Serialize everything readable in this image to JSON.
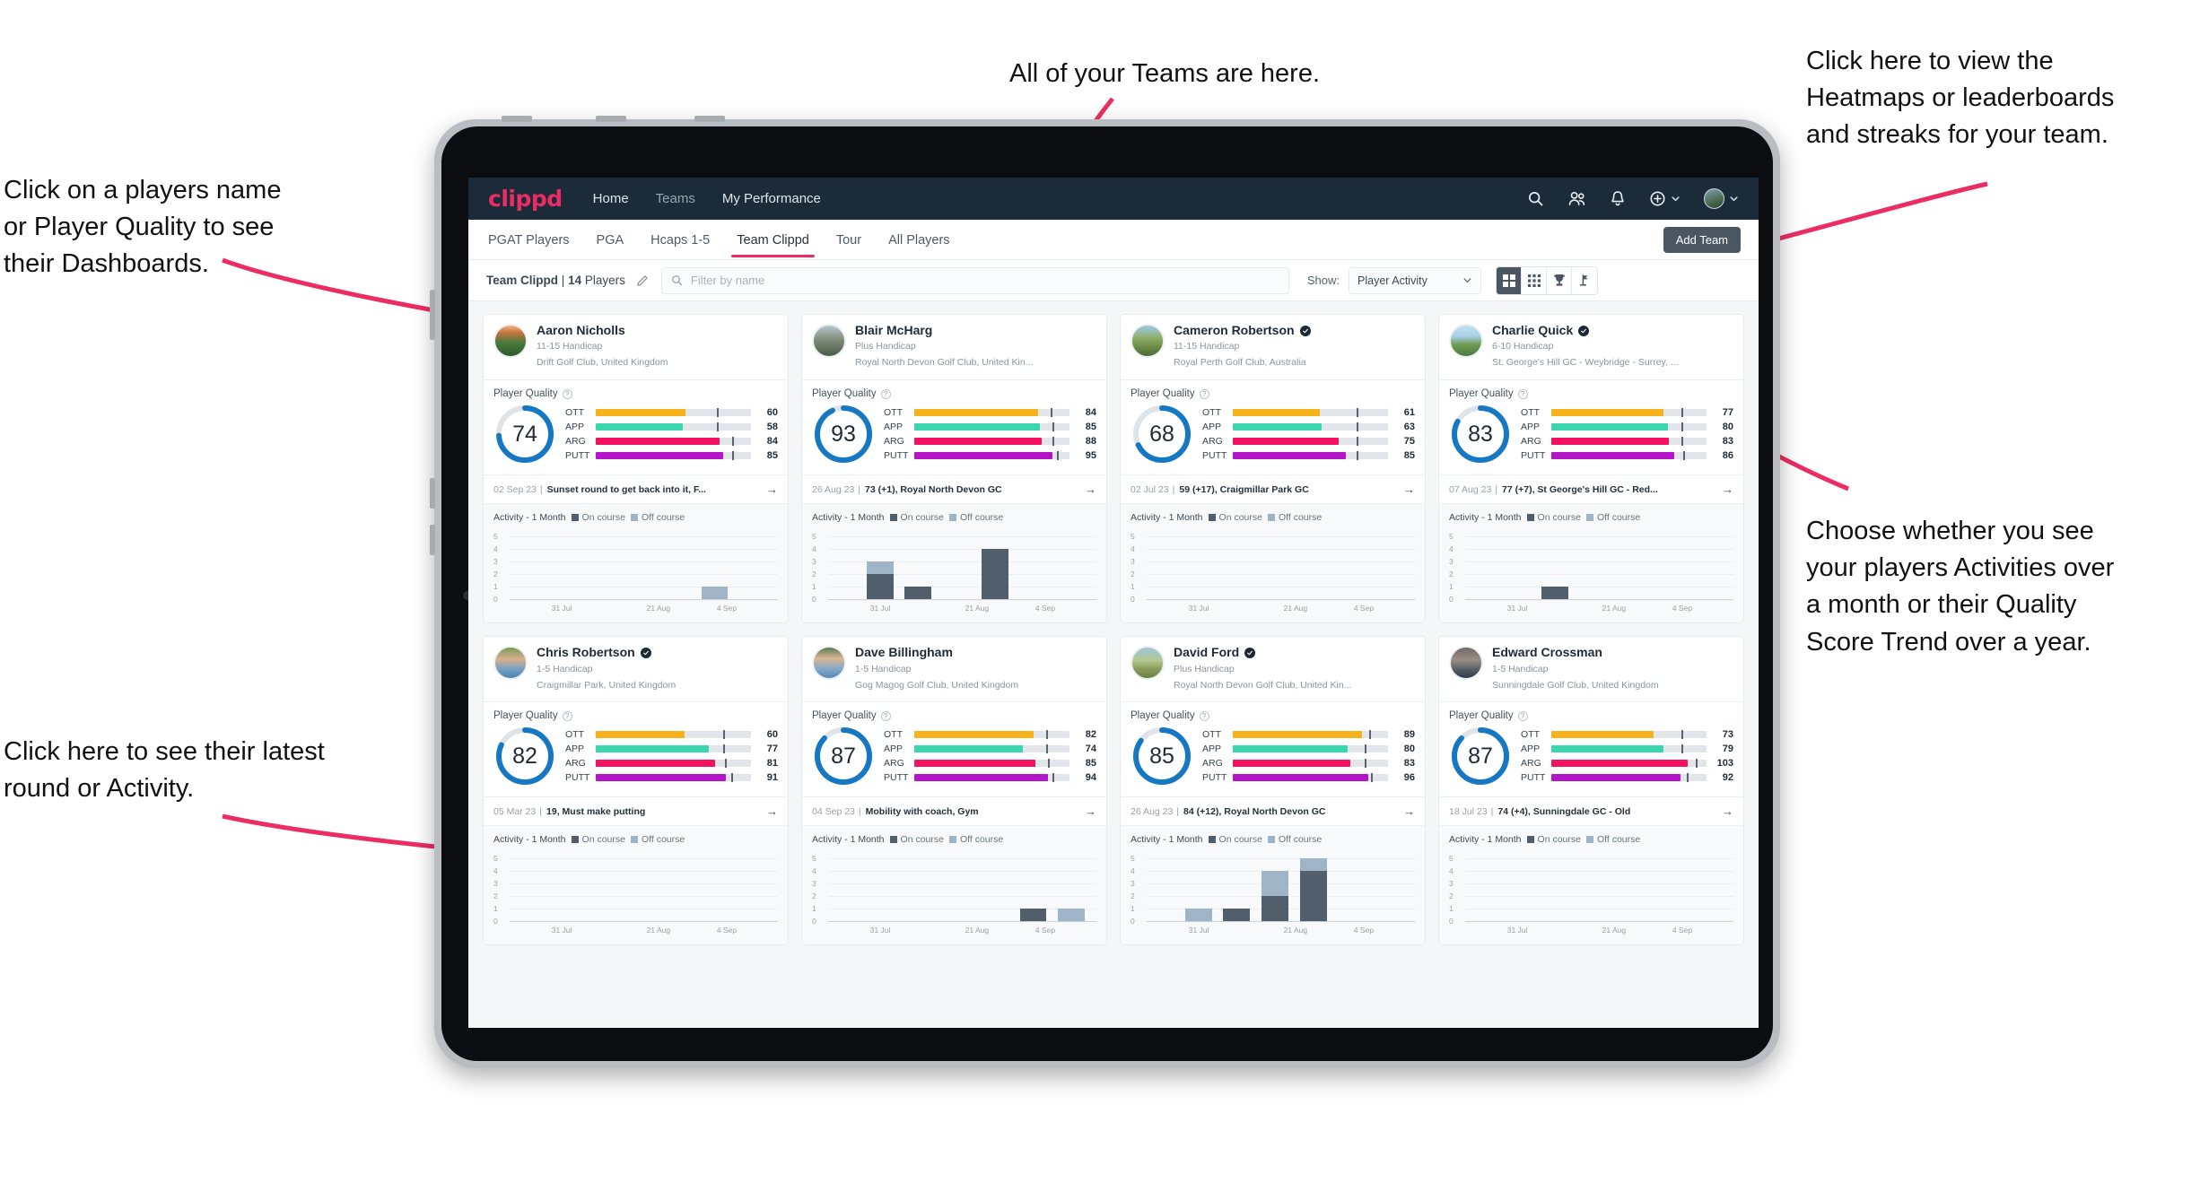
{
  "annotations": [
    {
      "id": "teams",
      "text": "All of your Teams are here."
    },
    {
      "id": "heatmaps",
      "text": "Click here to view the\nHeatmaps or leaderboards\nand streaks for your team."
    },
    {
      "id": "players-name",
      "text": "Click on a players name\nor Player Quality to see\ntheir Dashboards."
    },
    {
      "id": "activity-choice",
      "text": "Choose whether you see\nyour players Activities over\na month or their Quality\nScore Trend over a year."
    },
    {
      "id": "latest-round",
      "text": "Click here to see their latest\nround or Activity."
    }
  ],
  "app": {
    "logo": "clippd",
    "nav": [
      {
        "label": "Home",
        "active": true
      },
      {
        "label": "Teams",
        "active": false
      },
      {
        "label": "My Performance",
        "active": true
      }
    ],
    "nav_icons": [
      "search-icon",
      "team-icon",
      "bell-icon",
      "plus-circle-icon",
      "avatar"
    ],
    "tabs": [
      {
        "label": "PGAT Players",
        "active": false
      },
      {
        "label": "PGA",
        "active": false
      },
      {
        "label": "Hcaps 1-5",
        "active": false
      },
      {
        "label": "Team Clippd",
        "active": true
      },
      {
        "label": "Tour",
        "active": false
      },
      {
        "label": "All Players",
        "active": false
      }
    ],
    "add_team_label": "Add Team",
    "filter": {
      "team_name": "Team Clippd",
      "team_count": "14",
      "team_count_suffix": "Players",
      "separator": "|",
      "search_placeholder": "Filter by name",
      "show_label": "Show:",
      "show_value": "Player Activity",
      "view_modes": [
        "grid-view-icon",
        "dense-grid-icon",
        "trophy-icon",
        "golf-pin-icon"
      ],
      "active_view": 0
    },
    "accent": "#ec2d63",
    "ring_color": "#1678c2",
    "metric_colors": {
      "OTT": "#f7b21b",
      "APP": "#3ad6ae",
      "ARG": "#f5115f",
      "PUTT": "#b515c9"
    }
  },
  "card_labels": {
    "player_quality": "Player Quality",
    "activity": "Activity - 1 Month",
    "on_course": "On course",
    "off_course": "Off course",
    "metric_names": [
      "OTT",
      "APP",
      "ARG",
      "PUTT"
    ]
  },
  "chart_data": {
    "type": "bar",
    "title": "Activity - 1 Month",
    "ylabel": "",
    "xlabel": "",
    "ylim": [
      0,
      5
    ],
    "yticks": [
      0,
      1,
      2,
      3,
      4,
      5
    ],
    "xticks": [
      "31 Jul",
      "21 Aug",
      "4 Sep"
    ],
    "legend": [
      "On course",
      "Off course"
    ],
    "legend_position": "top",
    "grid": true,
    "series_colors": {
      "on_course": "#515e6b",
      "off_course": "#9fb4c6"
    },
    "panels": [
      {
        "player": "Aaron Nicholls",
        "bars": [
          {
            "slot": 5,
            "on": 0,
            "off": 1
          }
        ]
      },
      {
        "player": "Blair McHarg",
        "bars": [
          {
            "slot": 1,
            "on": 2,
            "off": 1
          },
          {
            "slot": 2,
            "on": 1,
            "off": 0
          },
          {
            "slot": 4,
            "on": 4,
            "off": 0
          }
        ]
      },
      {
        "player": "Cameron Robertson",
        "bars": []
      },
      {
        "player": "Charlie Quick",
        "bars": [
          {
            "slot": 2,
            "on": 1,
            "off": 0
          }
        ]
      },
      {
        "player": "Chris Robertson",
        "bars": []
      },
      {
        "player": "Dave Billingham",
        "bars": [
          {
            "slot": 5,
            "on": 1,
            "off": 0
          },
          {
            "slot": 6,
            "on": 0,
            "off": 1
          }
        ]
      },
      {
        "player": "David Ford",
        "bars": [
          {
            "slot": 1,
            "on": 0,
            "off": 1
          },
          {
            "slot": 2,
            "on": 1,
            "off": 0
          },
          {
            "slot": 3,
            "on": 2,
            "off": 2
          },
          {
            "slot": 4,
            "on": 4,
            "off": 1
          }
        ]
      },
      {
        "player": "Edward Crossman",
        "bars": []
      }
    ]
  },
  "players": [
    {
      "name": "Aaron Nicholls",
      "verified": false,
      "handicap": "11-15 Handicap",
      "club": "Drift Golf Club, United Kingdom",
      "quality": 74,
      "metrics": [
        {
          "label": "OTT",
          "value": 60,
          "fill": 58,
          "tick": 78
        },
        {
          "label": "APP",
          "value": 58,
          "fill": 56,
          "tick": 78
        },
        {
          "label": "ARG",
          "value": 84,
          "fill": 80,
          "tick": 88
        },
        {
          "label": "PUTT",
          "value": 85,
          "fill": 82,
          "tick": 88
        }
      ],
      "last_date": "02 Sep 23",
      "last_text": "Sunset round to get back into it, F...",
      "avatar_css": "linear-gradient(180deg,#f0b98a 0%,#c9753f 22%,#4a7a3d 55%,#2e5a2a 100%)"
    },
    {
      "name": "Blair McHarg",
      "verified": false,
      "handicap": "Plus Handicap",
      "club": "Royal North Devon Golf Club, United Kin...",
      "quality": 93,
      "metrics": [
        {
          "label": "OTT",
          "value": 84,
          "fill": 80,
          "tick": 88
        },
        {
          "label": "APP",
          "value": 85,
          "fill": 81,
          "tick": 89
        },
        {
          "label": "ARG",
          "value": 88,
          "fill": 82,
          "tick": 89
        },
        {
          "label": "PUTT",
          "value": 95,
          "fill": 89,
          "tick": 92
        }
      ],
      "last_date": "26 Aug 23",
      "last_text": "73 (+1), Royal North Devon GC",
      "avatar_css": "linear-gradient(180deg,#b9c7d1 0%,#7f8f7a 45%,#4a5c45 100%)"
    },
    {
      "name": "Cameron Robertson",
      "verified": true,
      "handicap": "11-15 Handicap",
      "club": "Royal Perth Golf Club, Australia",
      "quality": 68,
      "metrics": [
        {
          "label": "OTT",
          "value": 61,
          "fill": 56,
          "tick": 80
        },
        {
          "label": "APP",
          "value": 63,
          "fill": 57,
          "tick": 80
        },
        {
          "label": "ARG",
          "value": 75,
          "fill": 68,
          "tick": 80
        },
        {
          "label": "PUTT",
          "value": 85,
          "fill": 73,
          "tick": 80
        }
      ],
      "last_date": "02 Jul 23",
      "last_text": "59 (+17), Craigmillar Park GC",
      "avatar_css": "linear-gradient(180deg,#9ec9e8 0%,#8fae6b 40%,#6b8b45 70%,#4a6b3a 100%)"
    },
    {
      "name": "Charlie Quick",
      "verified": true,
      "handicap": "6-10 Handicap",
      "club": "St. George's Hill GC - Weybridge - Surrey, ...",
      "quality": 83,
      "metrics": [
        {
          "label": "OTT",
          "value": 77,
          "fill": 72,
          "tick": 84
        },
        {
          "label": "APP",
          "value": 80,
          "fill": 75,
          "tick": 84
        },
        {
          "label": "ARG",
          "value": 83,
          "fill": 76,
          "tick": 84
        },
        {
          "label": "PUTT",
          "value": 86,
          "fill": 79,
          "tick": 85
        }
      ],
      "last_date": "07 Aug 23",
      "last_text": "77 (+7), St George's Hill GC - Red...",
      "avatar_css": "linear-gradient(180deg,#bfe0f2 0%,#a8d0e6 35%,#6f9c52 62%,#4d7a3c 100%)"
    },
    {
      "name": "Chris Robertson",
      "verified": true,
      "handicap": "1-5 Handicap",
      "club": "Craigmillar Park, United Kingdom",
      "quality": 82,
      "metrics": [
        {
          "label": "OTT",
          "value": 60,
          "fill": 57,
          "tick": 82
        },
        {
          "label": "APP",
          "value": 77,
          "fill": 73,
          "tick": 82
        },
        {
          "label": "ARG",
          "value": 81,
          "fill": 77,
          "tick": 83
        },
        {
          "label": "PUTT",
          "value": 91,
          "fill": 84,
          "tick": 87
        }
      ],
      "last_date": "05 Mar 23",
      "last_text": "19, Must make putting",
      "avatar_css": "linear-gradient(180deg,#7a9c5a 0%,#d8b08c 38%,#6d9ec4 74%,#4f7fa8 100%)"
    },
    {
      "name": "Dave Billingham",
      "verified": false,
      "handicap": "1-5 Handicap",
      "club": "Gog Magog Golf Club, United Kingdom",
      "quality": 87,
      "metrics": [
        {
          "label": "OTT",
          "value": 82,
          "fill": 77,
          "tick": 85
        },
        {
          "label": "APP",
          "value": 74,
          "fill": 70,
          "tick": 85
        },
        {
          "label": "ARG",
          "value": 85,
          "fill": 78,
          "tick": 86
        },
        {
          "label": "PUTT",
          "value": 94,
          "fill": 86,
          "tick": 89
        }
      ],
      "last_date": "04 Sep 23",
      "last_text": "Mobility with coach, Gym",
      "avatar_css": "linear-gradient(180deg,#5d7a4e 0%,#d9b492 35%,#7fa8cc 72%,#5b87b0 100%)"
    },
    {
      "name": "David Ford",
      "verified": true,
      "handicap": "Plus Handicap",
      "club": "Royal North Devon Golf Club, United Kin...",
      "quality": 85,
      "metrics": [
        {
          "label": "OTT",
          "value": 89,
          "fill": 83,
          "tick": 88
        },
        {
          "label": "APP",
          "value": 80,
          "fill": 74,
          "tick": 85
        },
        {
          "label": "ARG",
          "value": 83,
          "fill": 76,
          "tick": 85
        },
        {
          "label": "PUTT",
          "value": 96,
          "fill": 87,
          "tick": 89
        }
      ],
      "last_date": "26 Aug 23",
      "last_text": "84 (+12), Royal North Devon GC",
      "avatar_css": "linear-gradient(180deg,#9fc4e0 0%,#b5c98f 42%,#8a9c5c 70%,#6d7f45 100%)"
    },
    {
      "name": "Edward Crossman",
      "verified": false,
      "handicap": "1-5 Handicap",
      "club": "Sunningdale Golf Club, United Kingdom",
      "quality": 87,
      "metrics": [
        {
          "label": "OTT",
          "value": 73,
          "fill": 66,
          "tick": 84
        },
        {
          "label": "APP",
          "value": 79,
          "fill": 72,
          "tick": 84
        },
        {
          "label": "ARG",
          "value": 103,
          "fill": 88,
          "tick": 93
        },
        {
          "label": "PUTT",
          "value": 92,
          "fill": 83,
          "tick": 87
        }
      ],
      "last_date": "18 Jul 23",
      "last_text": "74 (+4), Sunningdale GC - Old",
      "avatar_css": "linear-gradient(180deg,#6e6a66 0%,#9b8e84 40%,#4f5a62 75%,#343c44 100%)"
    }
  ]
}
